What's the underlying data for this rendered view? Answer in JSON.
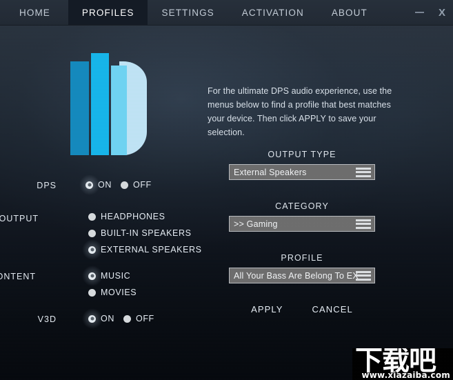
{
  "window": {
    "tabs": [
      {
        "label": "HOME",
        "active": false
      },
      {
        "label": "PROFILES",
        "active": true
      },
      {
        "label": "SETTINGS",
        "active": false
      },
      {
        "label": "ACTIVATION",
        "active": false
      },
      {
        "label": "ABOUT",
        "active": false
      }
    ],
    "minimize_icon": "minimize-icon",
    "close_label": "X"
  },
  "logo": {
    "name": "dps-b-logo",
    "colors": [
      "#1489bd",
      "#16b5ea",
      "#6fd3f2",
      "#bfe3f5"
    ]
  },
  "intro": {
    "text": "For the ultimate DPS audio experience, use the menus below to find a profile that best matches your device. Then click APPLY to save your selection."
  },
  "dropdowns": [
    {
      "label": "OUTPUT TYPE",
      "value": "External Speakers",
      "icon": "hamburger-menu-icon"
    },
    {
      "label": "CATEGORY",
      "value": ">> Gaming",
      "icon": "hamburger-menu-icon"
    },
    {
      "label": "PROFILE",
      "value": "All Your Bass Are Belong To EX",
      "icon": "hamburger-menu-icon"
    }
  ],
  "settings": {
    "dps": {
      "label": "DPS",
      "options": [
        {
          "label": "ON",
          "selected": true
        },
        {
          "label": "OFF",
          "selected": false
        }
      ]
    },
    "output": {
      "label": "OUTPUT",
      "options": [
        {
          "label": "HEADPHONES",
          "selected": false
        },
        {
          "label": "BUILT-IN SPEAKERS",
          "selected": false
        },
        {
          "label": "EXTERNAL SPEAKERS",
          "selected": true
        }
      ]
    },
    "content": {
      "label": "CONTENT",
      "options": [
        {
          "label": "MUSIC",
          "selected": true
        },
        {
          "label": "MOVIES",
          "selected": false
        }
      ]
    },
    "v3d": {
      "label": "V3D",
      "options": [
        {
          "label": "ON",
          "selected": true
        },
        {
          "label": "OFF",
          "selected": false
        }
      ]
    }
  },
  "actions": {
    "apply_label": "APPLY",
    "cancel_label": "CANCEL"
  },
  "watermark": {
    "logo_text": "下载吧",
    "url": "www.xiazaiba.com"
  }
}
